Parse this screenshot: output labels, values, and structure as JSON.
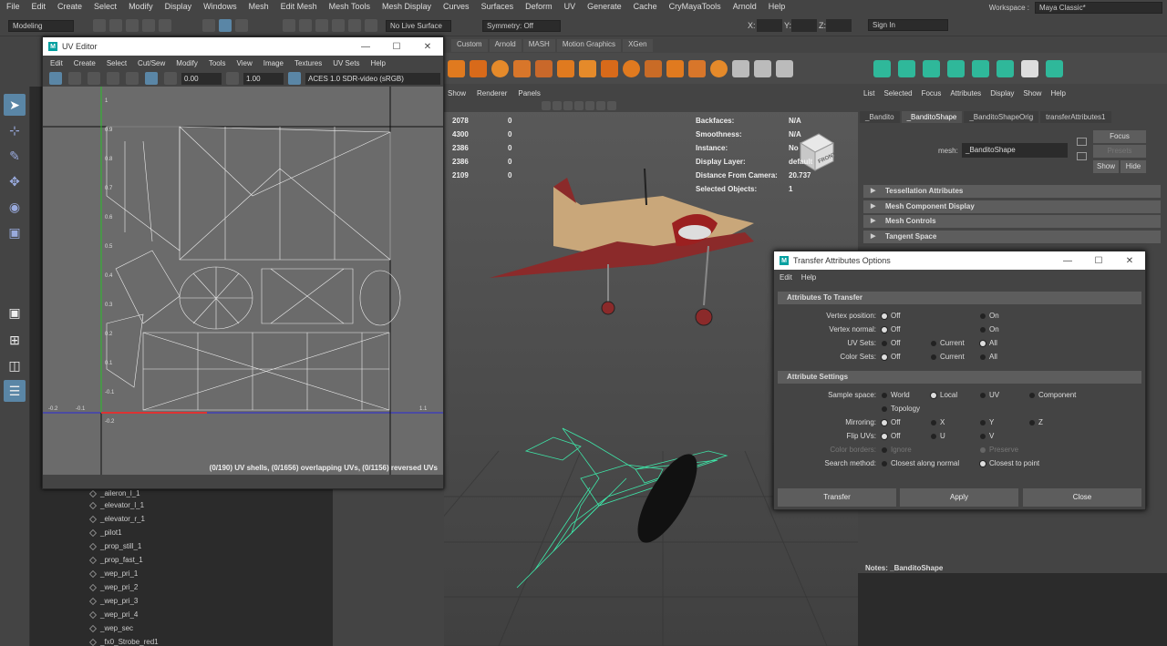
{
  "menubar": [
    "File",
    "Edit",
    "Create",
    "Select",
    "Modify",
    "Display",
    "Windows",
    "Mesh",
    "Edit Mesh",
    "Mesh Tools",
    "Mesh Display",
    "Curves",
    "Surfaces",
    "Deform",
    "UV",
    "Generate",
    "Cache",
    "CryMayaTools",
    "Arnold",
    "Help"
  ],
  "workspace": {
    "label": "Workspace :",
    "value": "Maya Classic*"
  },
  "statusline": {
    "mode": "Modeling",
    "live": "No Live Surface",
    "symmetry": "Symmetry: Off",
    "x": "X:",
    "y": "Y:",
    "z": "Z:",
    "signin": "Sign In"
  },
  "shelf_tabs": [
    "Custom",
    "Arnold",
    "MASH",
    "Motion Graphics",
    "XGen"
  ],
  "viewport": {
    "menu": [
      "Show",
      "Renderer",
      "Panels"
    ],
    "hud_counts": [
      "2078",
      "4300",
      "2386",
      "2386",
      "2109"
    ],
    "hud_zero": "0",
    "hud_labels": [
      "Backfaces:",
      "Smoothness:",
      "Instance:",
      "Display Layer:",
      "Distance From Camera:",
      "Selected Objects:"
    ],
    "hud_values": [
      "N/A",
      "N/A",
      "No",
      "default",
      "20.737",
      "1"
    ],
    "viewcube_label": "FRONT"
  },
  "outliner": [
    "_aileron_l_1",
    "_elevator_l_1",
    "_elevator_r_1",
    "_pilot1",
    "_prop_still_1",
    "_prop_fast_1",
    "_wep_pri_1",
    "_wep_pri_2",
    "_wep_pri_3",
    "_wep_pri_4",
    "_wep_sec",
    "_fx0_Strobe_red1"
  ],
  "uv_editor": {
    "title": "UV Editor",
    "menu": [
      "Edit",
      "Create",
      "Select",
      "Cut/Sew",
      "Modify",
      "Tools",
      "View",
      "Image",
      "Textures",
      "UV Sets",
      "Help"
    ],
    "field1": "0.00",
    "field2": "1.00",
    "colorspace": "ACES 1.0 SDR-video (sRGB)",
    "ticks_v": [
      "1",
      "0.9",
      "0.8",
      "0.7",
      "0.6",
      "0.5",
      "0.4",
      "0.3",
      "0.2",
      "0.1",
      "-0.1",
      "-0.2"
    ],
    "ticks_h": [
      "-0.2",
      "-0.1",
      "1.1"
    ],
    "status": "(0/190) UV shells, (0/1656) overlapping UVs, (0/1156) reversed UVs"
  },
  "attribute_editor": {
    "menu": [
      "List",
      "Selected",
      "Focus",
      "Attributes",
      "Display",
      "Show",
      "Help"
    ],
    "tabs": [
      "_Bandito",
      "_BanditoShape",
      "_BanditoShapeOrig",
      "transferAttributes1"
    ],
    "mesh_label": "mesh:",
    "mesh_value": "_BanditoShape",
    "focus_button": "Focus",
    "presets_button": "Presets",
    "show_button": "Show",
    "hide_button": "Hide",
    "sections": [
      "Tessellation Attributes",
      "Mesh Component Display",
      "Mesh Controls",
      "Tangent Space"
    ],
    "notes_label": "Notes: _BanditoShape"
  },
  "dialog": {
    "title": "Transfer Attributes Options",
    "menu": [
      "Edit",
      "Help"
    ],
    "section1": "Attributes To Transfer",
    "section2": "Attribute Settings",
    "labels": {
      "vertex_position": "Vertex position:",
      "vertex_normal": "Vertex normal:",
      "uv_sets": "UV Sets:",
      "color_sets": "Color Sets:",
      "sample_space": "Sample space:",
      "mirroring": "Mirroring:",
      "flip_uvs": "Flip UVs:",
      "color_borders": "Color borders:",
      "search_method": "Search method:"
    },
    "options": {
      "off": "Off",
      "on": "On",
      "current": "Current",
      "all": "All",
      "world": "World",
      "local": "Local",
      "uv": "UV",
      "component": "Component",
      "topology": "Topology",
      "x": "X",
      "y": "Y",
      "z": "Z",
      "u": "U",
      "v": "V",
      "ignore": "Ignore",
      "preserve": "Preserve",
      "closest_normal": "Closest along normal",
      "closest_point": "Closest to point"
    },
    "buttons": {
      "transfer": "Transfer",
      "apply": "Apply",
      "close": "Close"
    }
  }
}
